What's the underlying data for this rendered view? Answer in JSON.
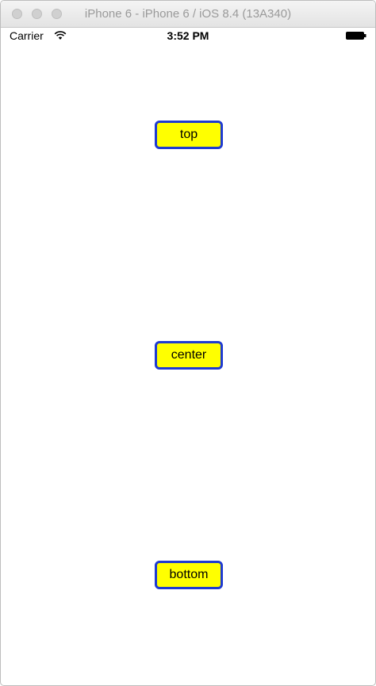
{
  "window": {
    "title": "iPhone 6 - iPhone 6 / iOS 8.4 (13A340)"
  },
  "statusbar": {
    "carrier": "Carrier",
    "time": "3:52 PM",
    "icons": [
      "wifi-icon",
      "battery-icon"
    ]
  },
  "buttons": {
    "top_label": "top",
    "center_label": "center",
    "bottom_label": "bottom"
  },
  "colors": {
    "button_fill": "#ffff00",
    "button_border": "#1f3bd1",
    "background": "#ffffff"
  }
}
